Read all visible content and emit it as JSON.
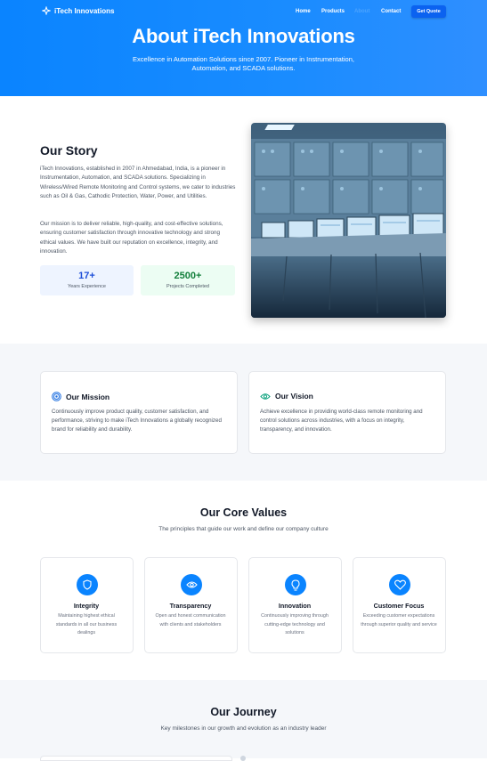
{
  "nav": {
    "logo_text": "iTech Innovations",
    "links": [
      "Home",
      "Products",
      "About",
      "Contact"
    ],
    "cta": "Get Quote",
    "accent": "#0a84ff"
  },
  "hero": {
    "title": "About iTech Innovations",
    "subtitle": "Excellence in Automation Solutions since 2007. Pioneer in Instrumentation, Automation, and SCADA solutions."
  },
  "story": {
    "title": "Our Story",
    "paragraph_1": "iTech Innovations, established in 2007 in Ahmedabad, India, is a pioneer in Instrumentation, Automation, and SCADA solutions. Specializing in Wireless/Wired Remote Monitoring and Control systems, we cater to industries such as Oil & Gas, Cathodic Protection, Water, Power, and Utilities.",
    "paragraph_2": "Our mission is to deliver reliable, high-quality, and cost-effective solutions, ensuring customer satisfaction through innovative technology and strong ethical values. We have built our reputation on excellence, integrity, and innovation.",
    "stats": [
      {
        "value": "17+",
        "label": "Years Experience"
      },
      {
        "value": "2500+",
        "label": "Projects Completed"
      }
    ],
    "image_icon": "control-room-image"
  },
  "mission": {
    "title": "Our Mission",
    "icon": "target-icon",
    "text": "Continuously improve product quality, customer satisfaction, and performance, striving to make iTech Innovations a globally recognized brand for reliability and durability."
  },
  "vision": {
    "title": "Our Vision",
    "icon": "eye-icon",
    "text": "Achieve excellence in providing world-class remote monitoring and control solutions across industries, with a focus on integrity, transparency, and innovation."
  },
  "values": {
    "title": "Our Core Values",
    "subtitle": "The principles that guide our work and define our company culture",
    "items": [
      {
        "title": "Integrity",
        "icon": "shield-icon",
        "text": "Maintaining highest ethical standards in all our business dealings"
      },
      {
        "title": "Transparency",
        "icon": "eye-icon",
        "text": "Open and honest communication with clients and stakeholders"
      },
      {
        "title": "Innovation",
        "icon": "lightbulb-icon",
        "text": "Continuously improving through cutting-edge technology and solutions"
      },
      {
        "title": "Customer Focus",
        "icon": "heart-icon",
        "text": "Exceeding customer expectations through superior quality and service"
      }
    ]
  },
  "journey": {
    "title": "Our Journey",
    "subtitle": "Key milestones in our growth and evolution as an industry leader"
  }
}
